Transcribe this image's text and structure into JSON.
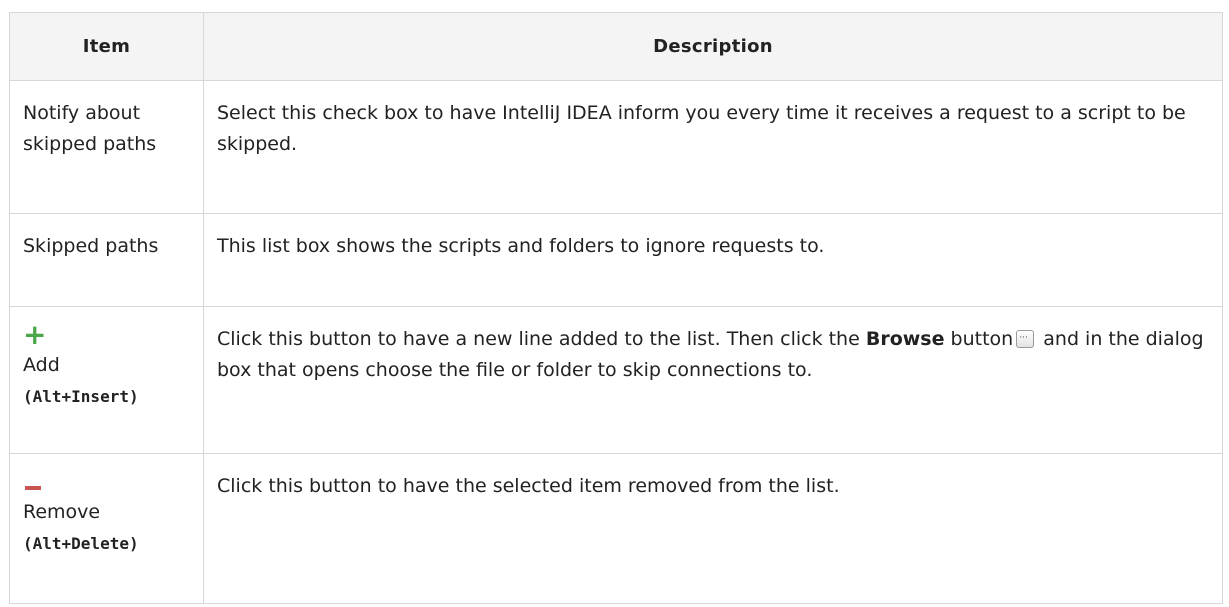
{
  "table": {
    "headers": {
      "item": "Item",
      "description": "Description"
    },
    "rows": [
      {
        "item": "Notify about skipped paths",
        "description": "Select this check box to have IntelliJ IDEA inform you every time it receives a request to a script to be skipped."
      },
      {
        "item": "Skipped paths",
        "description": "This list box shows the scripts and folders to ignore requests to."
      },
      {
        "icon": "plus-icon",
        "item": "Add",
        "shortcut": "(Alt+Insert)",
        "desc_part1": "Click this button to have a new line added to the list. Then click the ",
        "desc_bold": "Browse",
        "desc_part2": " button",
        "desc_icon": "browse-icon",
        "desc_part3": " and in the dialog box that opens choose the file or folder to skip connections to."
      },
      {
        "icon": "minus-icon",
        "item": "Remove",
        "shortcut": "(Alt+Delete)",
        "description": "Click this button to have the selected item removed from the list."
      }
    ]
  },
  "colors": {
    "add_icon": "#4aa84a",
    "remove_icon": "#c75450",
    "border": "#d7d7d7",
    "header_bg": "#f4f4f4"
  }
}
